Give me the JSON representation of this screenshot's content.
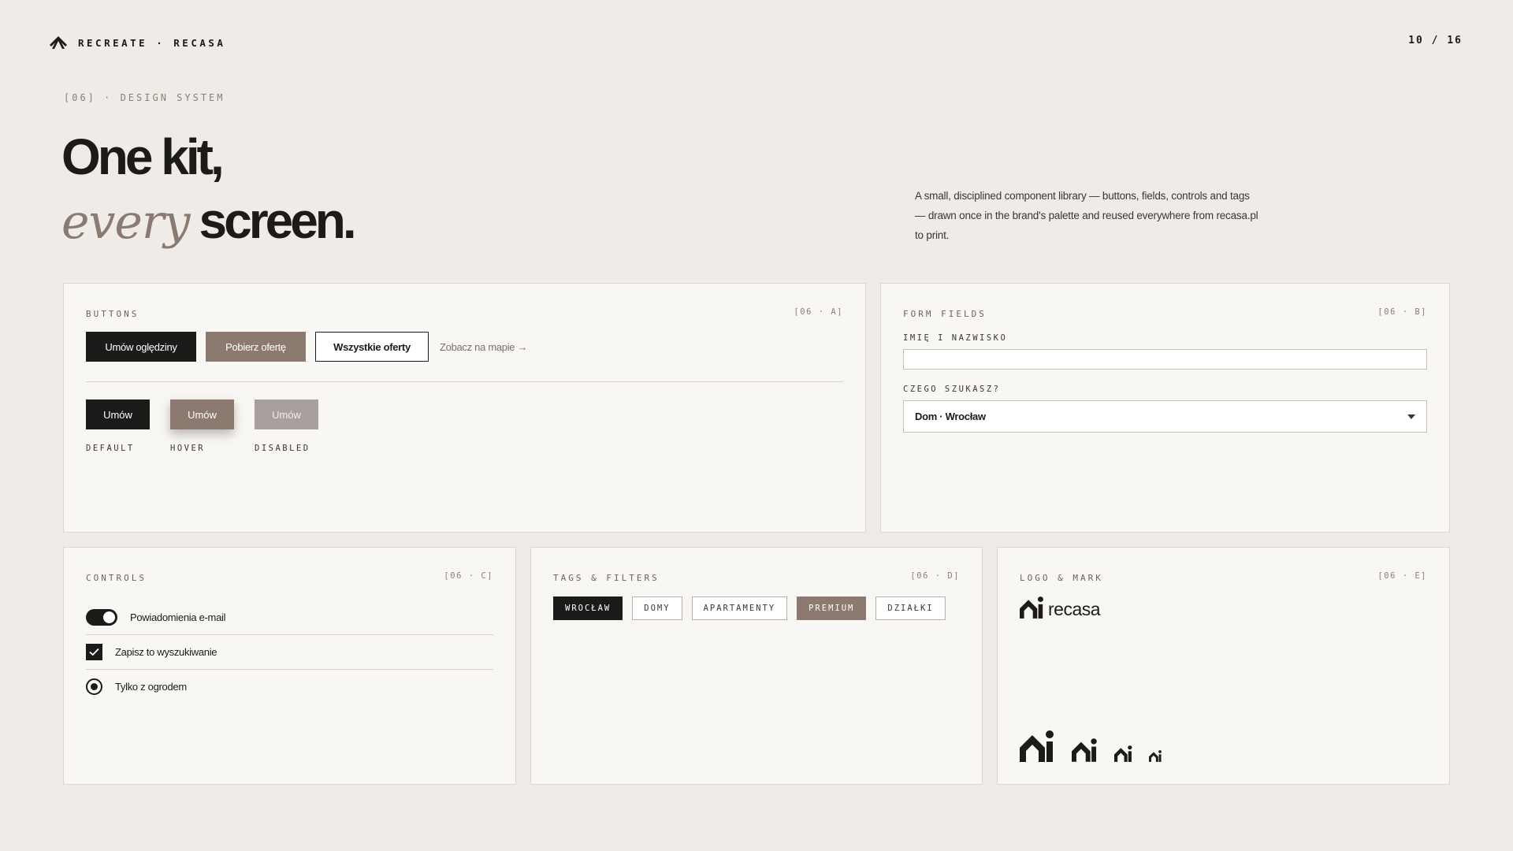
{
  "header": {
    "brand": "RECREATE · RECASA",
    "pager": "10 / 16"
  },
  "intro": {
    "section_label": "[06] · DESIGN SYSTEM",
    "headline_line1": "One kit,",
    "headline_italic": "every",
    "headline_bold": "screen.",
    "description": "A small, disciplined component library — buttons, fields, controls and tags — drawn once in the brand's palette and reused everywhere from recasa.pl to print."
  },
  "buttons_card": {
    "title": "BUTTONS",
    "code": "[06 · A]",
    "primary": "Umów oględziny",
    "secondary": "Pobierz ofertę",
    "outline": "Wszystkie oferty",
    "link": "Zobacz na mapie →",
    "states": [
      {
        "button": "Umów",
        "label": "DEFAULT"
      },
      {
        "button": "Umów",
        "label": "HOVER"
      },
      {
        "button": "Umów",
        "label": "DISABLED"
      }
    ]
  },
  "fields_card": {
    "title": "FORM FIELDS",
    "code": "[06 · B]",
    "name_label": "IMIĘ I NAZWISKO",
    "name_value": "",
    "search_label": "CZEGO SZUKASZ?",
    "search_value": "Dom · Wrocław"
  },
  "controls_card": {
    "title": "CONTROLS",
    "code": "[06 · C]",
    "toggle_label": "Powiadomienia e-mail",
    "toggle_on": true,
    "checkbox_label": "Zapisz to wyszukiwanie",
    "checkbox_checked": true,
    "radio_label": "Tylko z ogrodem",
    "radio_selected": true
  },
  "tags_card": {
    "title": "TAGS & FILTERS",
    "code": "[06 · D]",
    "tags": [
      "WROCŁAW",
      "DOMY",
      "APARTAMENTY",
      "PREMIUM",
      "DZIAŁKI"
    ]
  },
  "logo_card": {
    "title": "LOGO & MARK",
    "code": "[06 · E]",
    "wordmark": "recasa"
  },
  "colors": {
    "background": "#efece8",
    "card": "#f9f7f4",
    "ink": "#1c1b1a",
    "taupe": "#8c7a70",
    "disabled": "#a8a09c"
  },
  "icons": [
    "brand-leaf-icon",
    "house-mark-icon",
    "checkmark-icon",
    "chevron-down-icon"
  ]
}
